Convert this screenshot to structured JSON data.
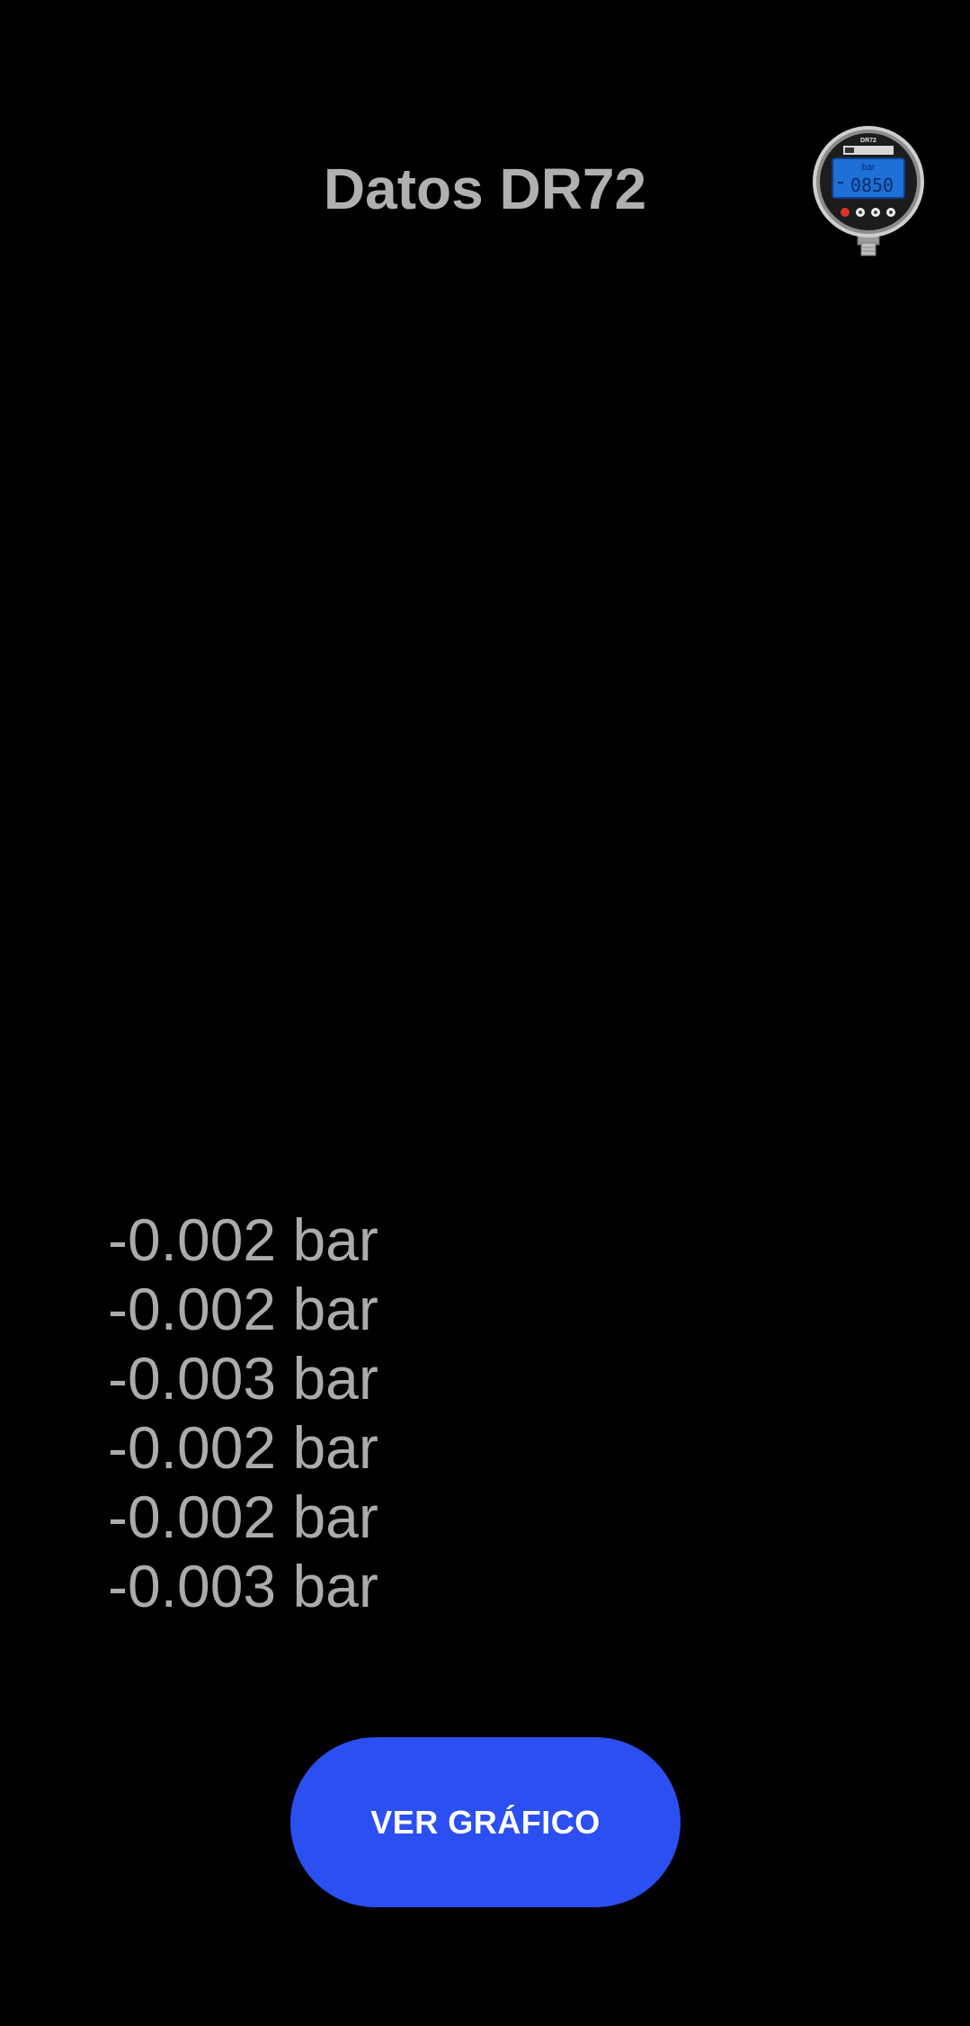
{
  "header": {
    "title": "Datos DR72",
    "device_icon": "pressure-gauge-icon"
  },
  "gauge": {
    "model": "DR72",
    "display_unit": "bar",
    "display_value": "0850"
  },
  "readings": [
    "-0.002 bar",
    "-0.002 bar",
    "-0.003 bar",
    "-0.002 bar",
    "-0.002 bar",
    "-0.003 bar"
  ],
  "actions": {
    "chart_button_label": "VER GRÁFICO"
  },
  "colors": {
    "background": "#000000",
    "text": "#b0b0b0",
    "button": "#2b4ff0",
    "button_text": "#ffffff"
  }
}
